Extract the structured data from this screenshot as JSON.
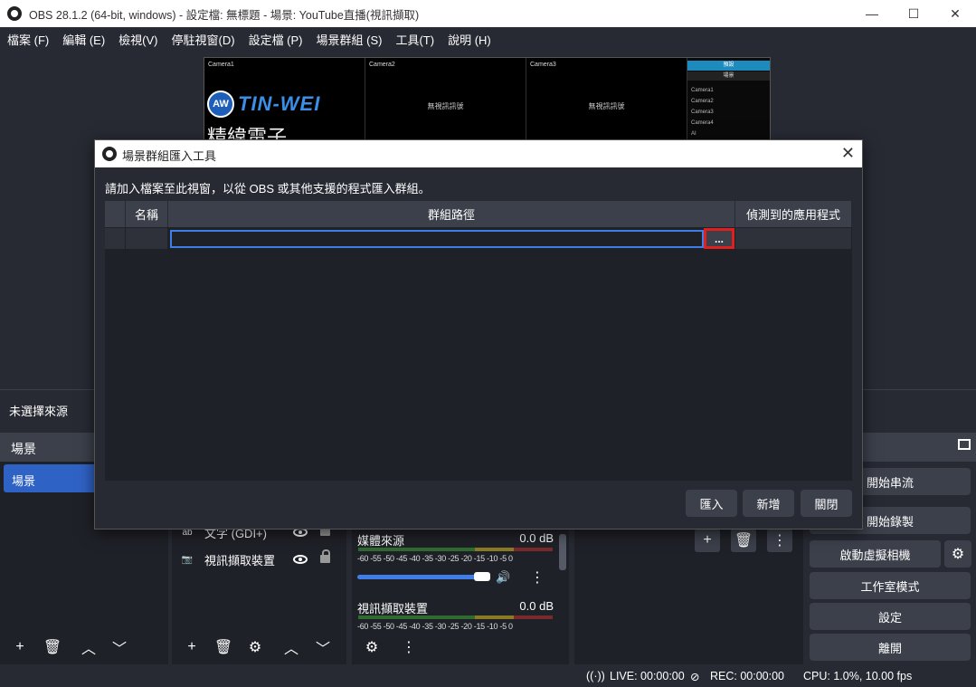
{
  "window": {
    "title": "OBS 28.1.2 (64-bit, windows) - 設定檔: 無標題 - 場景: YouTube直播(視訊擷取)",
    "minimize": "—",
    "maximize": "☐",
    "close": "✕"
  },
  "menu": {
    "items": [
      "檔案 (F)",
      "編輯 (E)",
      "檢視(V)",
      "停駐視窗(D)",
      "設定檔 (P)",
      "場景群組 (S)",
      "工具(T)",
      "說明 (H)"
    ]
  },
  "preview": {
    "cameras": [
      "Camera1",
      "Camera2",
      "Camera3"
    ],
    "no_signal": "無視訊訊號",
    "logo_badge": "AW",
    "logo_brand": "TIN-WEI",
    "logo_slogan": "精緯電子",
    "side_tab1": "預設",
    "side_tab2": "場景",
    "side_list": [
      "Camera1",
      "Camera2",
      "Camera3",
      "Camera4",
      "AI"
    ]
  },
  "sources_status": "未選擇來源",
  "scenes": {
    "header": "場景",
    "items": [
      "場景"
    ]
  },
  "sources": {
    "items": [
      {
        "icon": "ab",
        "label": "文字 (GDI+)"
      },
      {
        "icon": "📷",
        "label": "視訊擷取裝置"
      }
    ]
  },
  "mixer": {
    "channels": [
      {
        "name": "媒體來源",
        "db": "0.0 dB"
      },
      {
        "name": "視訊擷取裝置",
        "db": "0.0 dB"
      }
    ],
    "scale": "-60 -55 -50 -45 -40 -35 -30 -25 -20 -15 -10 -5 0",
    "volume_level": 0.92
  },
  "controls": {
    "start_stream": "開始串流",
    "start_record": "開始錄製",
    "virtual_cam": "啟動虛擬相機",
    "studio_mode": "工作室模式",
    "settings": "設定",
    "exit": "離開"
  },
  "statusbar": {
    "live": "LIVE: 00:00:00",
    "rec": "REC: 00:00:00",
    "cpu": "CPU: 1.0%, 10.00 fps"
  },
  "dialog": {
    "title": "場景群組匯入工具",
    "description": "請加入檔案至此視窗，以從 OBS 或其他支援的程式匯入群組。",
    "columns": [
      "名稱",
      "群組路徑",
      "偵測到的應用程式"
    ],
    "path_value": "",
    "browse_label": "...",
    "buttons": {
      "import": "匯入",
      "add": "新增",
      "close": "關閉"
    }
  },
  "colors": {
    "accent": "#2f62c5",
    "highlight": "#e0201f",
    "panel": "#1f2128",
    "background": "#272a33"
  }
}
